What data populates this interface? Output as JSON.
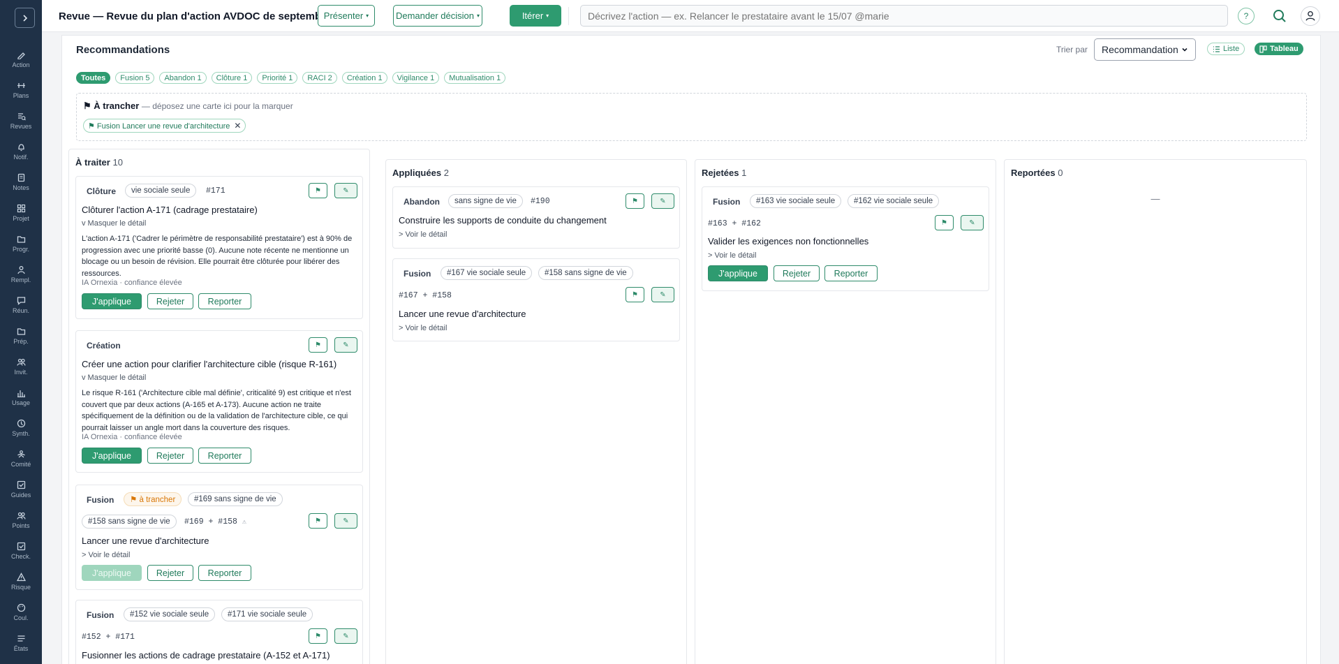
{
  "header": {
    "title": "Revue — Revue du plan d'action AVDOC de septembre",
    "present_label": "Présenter",
    "decision_label": "Demander décision",
    "iterate_label": "Itérer",
    "dropdown_caret": "▾",
    "command_placeholder": "Décrivez l'action — ex. Relancer le prestataire avant le 15/07 @marie",
    "help_label": "?"
  },
  "sidebar": {
    "items": [
      {
        "label": "Action",
        "icon": "pen-icon"
      },
      {
        "label": "Plans",
        "icon": "plans-icon"
      },
      {
        "label": "Revues",
        "icon": "review-icon"
      },
      {
        "label": "Notif.",
        "icon": "bell-icon"
      },
      {
        "label": "Notes",
        "icon": "notes-icon"
      },
      {
        "label": "Projet",
        "icon": "grid-icon"
      },
      {
        "label": "Progr.",
        "icon": "folder-icon"
      },
      {
        "label": "Rempl.",
        "icon": "person-icon"
      },
      {
        "label": "Réun.",
        "icon": "chat-icon"
      },
      {
        "label": "Prép.",
        "icon": "folder-icon"
      },
      {
        "label": "Invit.",
        "icon": "people-icon"
      },
      {
        "label": "Usage",
        "icon": "bar-chart-icon"
      },
      {
        "label": "Synth.",
        "icon": "clock-icon"
      },
      {
        "label": "Comité",
        "icon": "committee-icon"
      },
      {
        "label": "Guides",
        "icon": "check-square-icon"
      },
      {
        "label": "Points",
        "icon": "people-icon"
      },
      {
        "label": "Check.",
        "icon": "check-square-icon"
      },
      {
        "label": "Risque",
        "icon": "warning-icon"
      },
      {
        "label": "Coul.",
        "icon": "palette-icon"
      },
      {
        "label": "États",
        "icon": "list-icon"
      }
    ]
  },
  "main": {
    "title": "Recommandations",
    "sort_label": "Trier par",
    "sort_value": "Recommandation",
    "view_list": "Liste",
    "view_board": "Tableau",
    "filters": [
      "Toutes",
      "Fusion 5",
      "Abandon 1",
      "Clôture 1",
      "Priorité 1",
      "RACI 2",
      "Création 1",
      "Vigilance 1",
      "Mutualisation 1"
    ],
    "drop_zone": {
      "title": "⚑ À trancher",
      "hint": "— déposez une carte ici pour la marquer",
      "tag": "⚑ Fusion Lancer une revue d'architecture",
      "remove": "✕"
    },
    "flag_glyph": "⚑",
    "edit_glyph": "✎",
    "actions": {
      "apply": "J'applique",
      "reject": "Rejeter",
      "defer": "Reporter"
    }
  },
  "columns": {
    "todo": {
      "title": "À traiter",
      "count": "10",
      "cards": [
        {
          "type": "Clôture",
          "pill": "vie sociale seule",
          "ref": "#171",
          "title": "Clôturer l'action A-171 (cadrage prestataire)",
          "toggle": "v Masquer le détail",
          "desc": "L'action A-171 ('Cadrer le périmètre de responsabilité prestataire') est à 90% de progression avec une priorité basse (0). Aucune note récente ne mentionne un blocage ou un besoin de révision. Elle pourrait être clôturée pour libérer des ressources.",
          "meta": "IA Ornexia · confiance élevée"
        },
        {
          "type": "Création",
          "title": "Créer une action pour clarifier l'architecture cible (risque R-161)",
          "toggle": "v Masquer le détail",
          "desc": "Le risque R-161 ('Architecture cible mal définie', criticalité 9) est critique et n'est couvert que par deux actions (A-165 et A-173). Aucune action ne traite spécifiquement de la définition ou de la validation de l'architecture cible, ce qui pourrait laisser un angle mort dans la couverture des risques.",
          "meta": "IA Ornexia · confiance élevée"
        },
        {
          "type": "Fusion",
          "badge": "⚑ à trancher",
          "pill1": "#169 sans signe de vie",
          "pill2": "#158 sans signe de vie",
          "ref": "#169 + #158",
          "warn": "⚠",
          "title": "Lancer une revue d'architecture",
          "toggle": "> Voir le détail"
        },
        {
          "type": "Fusion",
          "pill1": "#152 vie sociale seule",
          "pill2": "#171 vie sociale seule",
          "ref": "#152 + #171",
          "title": "Fusionner les actions de cadrage prestataire (A-152 et A-171)"
        }
      ]
    },
    "applied": {
      "title": "Appliquées",
      "count": "2",
      "cards": [
        {
          "type": "Abandon",
          "pill": "sans signe de vie",
          "ref": "#190",
          "title": "Construire les supports de conduite du changement",
          "toggle": "> Voir le détail"
        },
        {
          "type": "Fusion",
          "pill1": "#167 vie sociale seule",
          "pill2": "#158 sans signe de vie",
          "ref": "#167 + #158",
          "title": "Lancer une revue d'architecture",
          "toggle": "> Voir le détail"
        }
      ]
    },
    "rejected": {
      "title": "Rejetées",
      "count": "1",
      "cards": [
        {
          "type": "Fusion",
          "pill1": "#163 vie sociale seule",
          "pill2": "#162 vie sociale seule",
          "ref": "#163 + #162",
          "title": "Valider les exigences non fonctionnelles",
          "toggle": "> Voir le détail"
        }
      ]
    },
    "deferred": {
      "title": "Reportées",
      "count": "0",
      "empty": "—"
    }
  },
  "colors": {
    "accent": "#2e9b70",
    "accent_dark": "#1f7a5a",
    "sidebar_bg": "#1f3147",
    "warn": "#d97706"
  }
}
